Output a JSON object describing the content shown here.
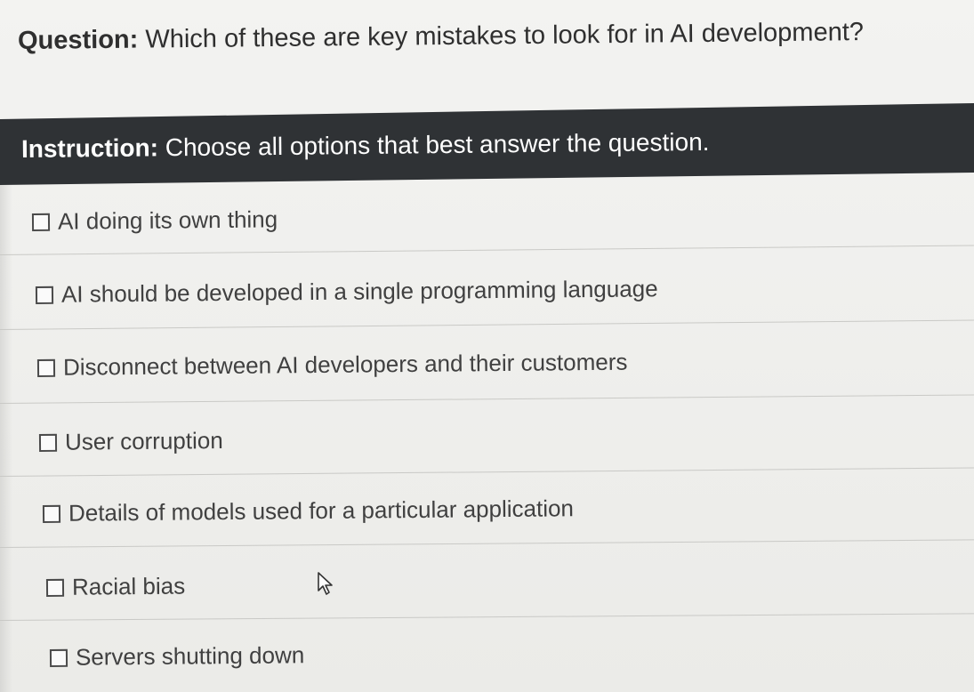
{
  "question": {
    "label": "Question:",
    "text": " Which of these are key mistakes to look for in AI development?"
  },
  "instruction": {
    "label": "Instruction:",
    "text": " Choose all options that best answer the question."
  },
  "options": [
    {
      "label": "AI doing its own thing",
      "checked": false
    },
    {
      "label": "AI should be developed in a single programming language",
      "checked": false
    },
    {
      "label": "Disconnect between AI developers and their customers",
      "checked": false
    },
    {
      "label": "User corruption",
      "checked": false
    },
    {
      "label": "Details of models used for a particular application",
      "checked": false
    },
    {
      "label": "Racial bias",
      "checked": false
    },
    {
      "label": "Servers shutting down",
      "checked": false
    }
  ],
  "icons": {
    "cursor": "mouse-pointer-icon"
  },
  "colors": {
    "instruction_bar": "#2f3235",
    "background": "#efefec",
    "text": "#404040"
  }
}
